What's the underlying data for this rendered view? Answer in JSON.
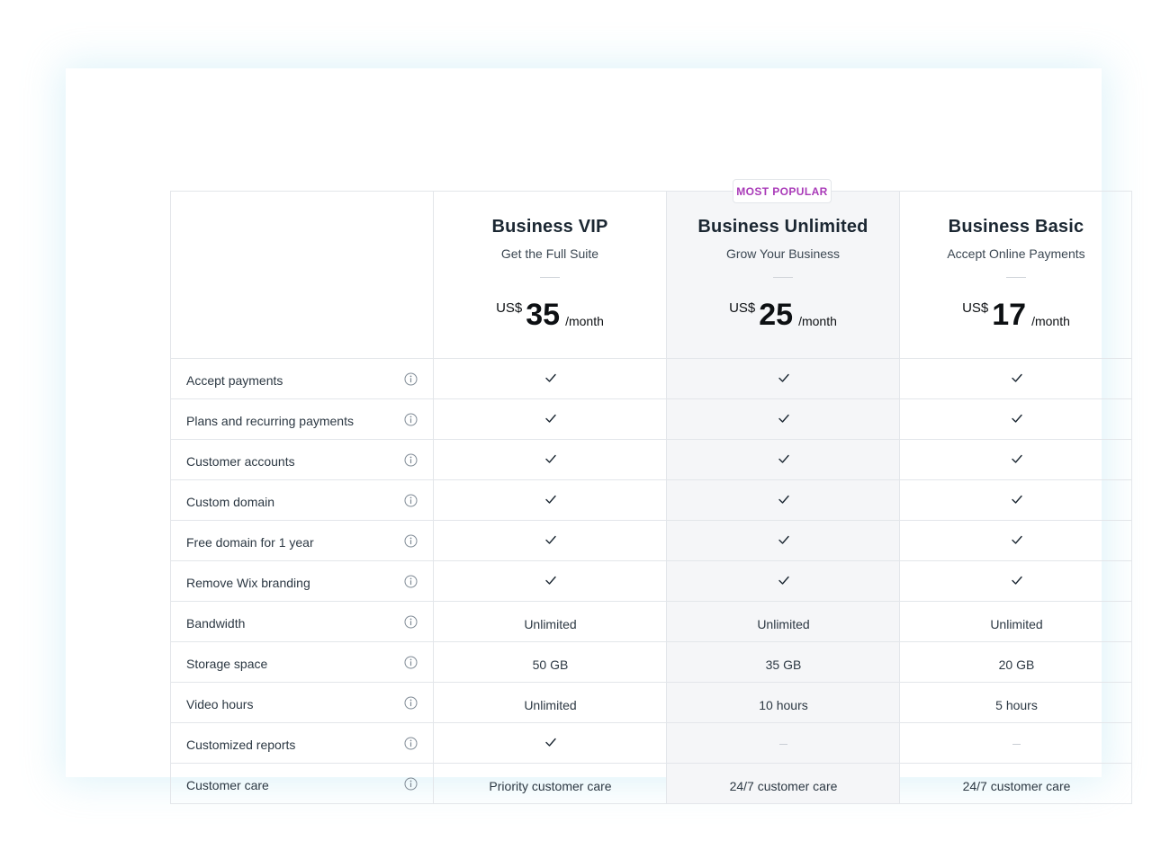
{
  "badge": "MOST POPULAR",
  "plans": [
    {
      "name": "Business VIP",
      "tagline": "Get the Full Suite",
      "currency": "US$",
      "price": "35",
      "period": "/month",
      "popular": false
    },
    {
      "name": "Business Unlimited",
      "tagline": "Grow Your Business",
      "currency": "US$",
      "price": "25",
      "period": "/month",
      "popular": true
    },
    {
      "name": "Business Basic",
      "tagline": "Accept Online Payments",
      "currency": "US$",
      "price": "17",
      "period": "/month",
      "popular": false
    }
  ],
  "features": [
    {
      "label": "Accept payments",
      "values": [
        "check",
        "check",
        "check"
      ]
    },
    {
      "label": "Plans and recurring payments",
      "values": [
        "check",
        "check",
        "check"
      ]
    },
    {
      "label": "Customer accounts",
      "values": [
        "check",
        "check",
        "check"
      ]
    },
    {
      "label": "Custom domain",
      "values": [
        "check",
        "check",
        "check"
      ]
    },
    {
      "label": "Free domain for 1 year",
      "values": [
        "check",
        "check",
        "check"
      ]
    },
    {
      "label": "Remove Wix branding",
      "values": [
        "check",
        "check",
        "check"
      ]
    },
    {
      "label": "Bandwidth",
      "values": [
        "Unlimited",
        "Unlimited",
        "Unlimited"
      ]
    },
    {
      "label": "Storage space",
      "values": [
        "50 GB",
        "35 GB",
        "20 GB"
      ]
    },
    {
      "label": "Video hours",
      "values": [
        "Unlimited",
        "10 hours",
        "5 hours"
      ]
    },
    {
      "label": "Customized reports",
      "values": [
        "check",
        "none",
        "none"
      ]
    },
    {
      "label": "Customer care",
      "values": [
        "Priority customer care",
        "24/7 customer care",
        "24/7 customer care"
      ]
    }
  ],
  "icons": {
    "feature_info": "info-circle-icon",
    "included": "checkmark-icon",
    "not_included": "dash-icon"
  },
  "colors": {
    "badge_text": "#a93ab8",
    "popular_column_bg": "#f5f6f8",
    "border": "#e3e6ea",
    "text": "#20303c"
  }
}
